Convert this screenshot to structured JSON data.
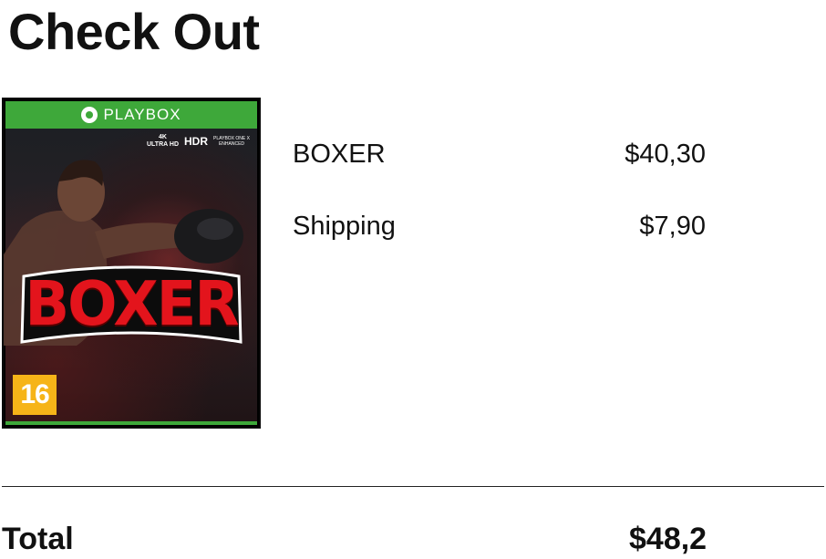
{
  "page": {
    "title": "Check Out"
  },
  "product_cover": {
    "brand": "PLAYBOX",
    "badge_4k_top": "4K",
    "badge_4k_bottom": "ULTRA HD",
    "badge_hdr": "HDR",
    "badge_enhanced_top": "PLAYBOX ONE X",
    "badge_enhanced_bottom": "ENHANCED",
    "game_title": "BOXER",
    "age_rating": "16",
    "colors": {
      "banner": "#3ea83a",
      "title_red": "#e3141c",
      "rating_yellow": "#f6b418"
    }
  },
  "order": {
    "items": [
      {
        "label": "BOXER",
        "price": "$40,30"
      },
      {
        "label": "Shipping",
        "price": "$7,90"
      }
    ],
    "total_label": "Total",
    "total_value": "$48,2"
  }
}
